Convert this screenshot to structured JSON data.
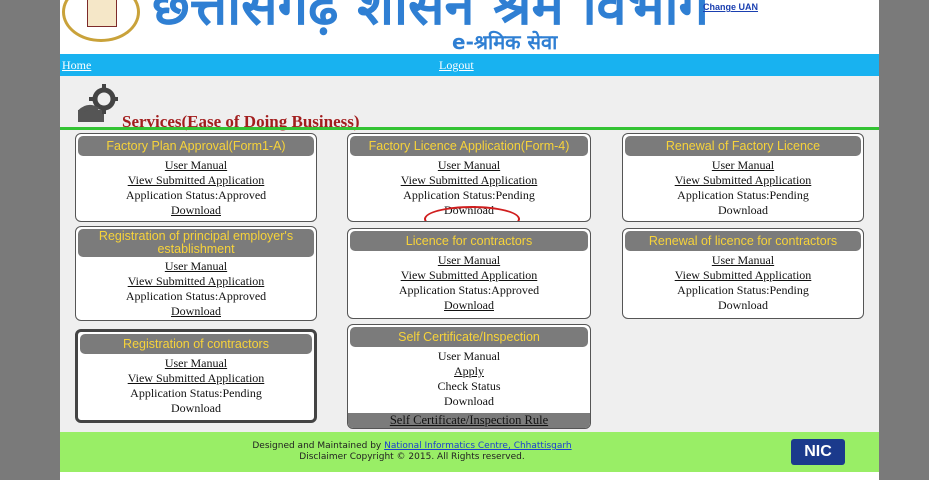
{
  "header": {
    "big_title": "छत्तीसगढ़ शासन श्रम विभाग",
    "sub_title": "e-श्रमिक सेवा",
    "change_uan": "Change UAN"
  },
  "nav": {
    "home": "Home",
    "logout": "Logout"
  },
  "services": {
    "title": "Services(Ease of Doing Business)",
    "cards": [
      {
        "title": "Factory Plan Approval(Form1-A)",
        "lines": [
          "User Manual",
          "View Submitted Application",
          "Application Status:Approved",
          "Download"
        ]
      },
      {
        "title": "Factory Licence Application(Form-4)",
        "lines": [
          "User Manual",
          "View Submitted Application",
          "Application Status:Pending",
          "Download"
        ]
      },
      {
        "title": "Renewal of Factory Licence",
        "lines": [
          "User Manual",
          "View Submitted Application",
          "Application Status:Pending",
          "Download"
        ]
      },
      {
        "title": "Registration of principal employer's establishment",
        "lines": [
          "User Manual",
          "View Submitted Application",
          "Application Status:Approved",
          "Download"
        ]
      },
      {
        "title": "Licence for contractors",
        "lines": [
          "User Manual",
          "View Submitted Application",
          "Application Status:Approved",
          "Download"
        ]
      },
      {
        "title": "Renewal of licence for contractors",
        "lines": [
          "User Manual",
          "View Submitted Application",
          "Application Status:Pending",
          "Download"
        ]
      },
      {
        "title": "Registration of contractors",
        "lines": [
          "User Manual",
          "View Submitted Application",
          "Application Status:Pending",
          "Download"
        ]
      },
      {
        "title": "Self Certificate/Inspection",
        "lines": [
          "User Manual",
          "Apply",
          "Check Status",
          "Download"
        ],
        "rule": "Self Certificate/Inspection Rule"
      }
    ]
  },
  "footer": {
    "designed_by": "Designed and Maintained by",
    "nic_link": "National Informatics Centre, Chhattisgarh",
    "disclaimer": "Disclaimer Copyright © 2015. All Rights reserved.",
    "logo_text": "NIC"
  },
  "colors": {
    "nav": "#18b2f0",
    "footer": "#99ee66",
    "title_accent": "#a21e1e",
    "card_header": "#7b7b7b",
    "card_header_text": "#f7d33a"
  }
}
